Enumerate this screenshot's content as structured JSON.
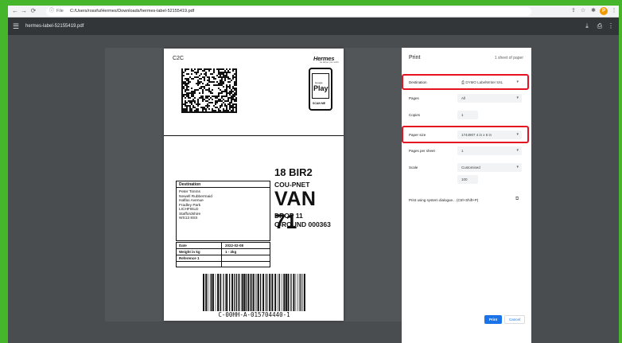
{
  "browser": {
    "info_glyph": "ⓘ",
    "file_label": "File",
    "url": "C:/Users/rossfu/Hermes/Downloads/hermes-label-52155419.pdf",
    "back_glyph": "←",
    "forward_glyph": "→",
    "reload_glyph": "⟳",
    "avatar_letter": "P"
  },
  "pdf_viewer": {
    "title": "hermes-label-52155419.pdf"
  },
  "label": {
    "service": "C2C",
    "brand": "Hermes",
    "brand_tagline": "we deliver your world",
    "play_small": "Google",
    "play": "Play",
    "scan_me": "SCAN ME",
    "route": "18 BIR2",
    "sub_route": "COU-PNET",
    "van": "VAN 71",
    "drop": "DROP 11",
    "round": "C-ROUND 000363",
    "destination_heading": "Destination",
    "address": [
      "Peter Timms",
      "Newell Rubbermaid",
      "Halfax Avenue",
      "Fradley Park",
      "LICHFIELD",
      "Staffordshire",
      "WS13 8SS"
    ],
    "info_rows": [
      {
        "label": "Date",
        "value": "2022-02-08"
      },
      {
        "label": "Weight in kg",
        "value": "1 - 2kg"
      },
      {
        "label": "Reference 1",
        "value": ""
      }
    ],
    "barcode_text": "C-00HH-A-015704440-1"
  },
  "print_panel": {
    "title": "Print",
    "sheet_count": "1 sheet of paper",
    "destination_label": "Destination",
    "destination_value": "DYMO LabelWriter 5XL",
    "pages_label": "Pages",
    "pages_value": "All",
    "copies_label": "Copies",
    "copies_value": "1",
    "paper_size_label": "Paper size",
    "paper_size_value": "1744907 4 in x 6 in",
    "pages_per_sheet_label": "Pages per sheet",
    "pages_per_sheet_value": "1",
    "scale_label": "Scale",
    "scale_value": "Customised",
    "scale_number": "100",
    "system_dialog": "Print using system dialogue... (Ctrl+Shift+P)",
    "print_button": "Print",
    "cancel_button": "Cancel"
  },
  "colors": {
    "frame_green": "#45b52c",
    "highlight_red": "#e5121f",
    "print_blue": "#1a73e8"
  }
}
